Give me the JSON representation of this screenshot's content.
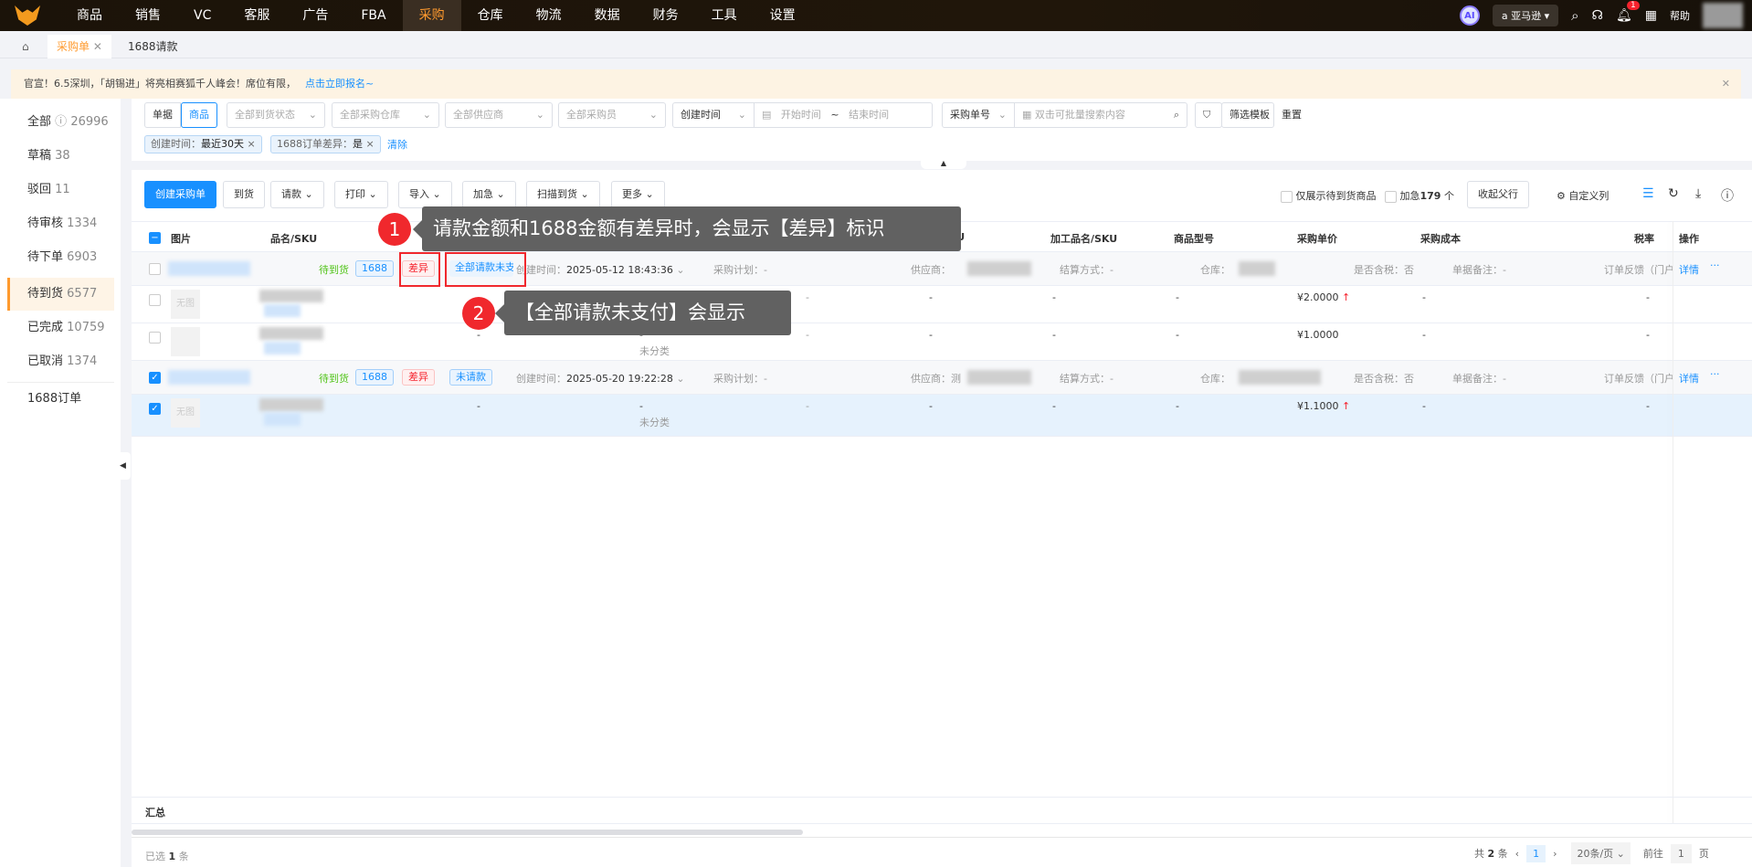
{
  "nav": {
    "items": [
      "商品",
      "销售",
      "VC",
      "客服",
      "广告",
      "FBA",
      "采购",
      "仓库",
      "物流",
      "数据",
      "财务",
      "工具",
      "设置"
    ],
    "active": "采购",
    "ai_label": "AI",
    "store": "亚马逊",
    "help": "帮助",
    "notification_count": "1"
  },
  "tabs": [
    {
      "label": "采购单",
      "active": true
    },
    {
      "label": "1688请款"
    }
  ],
  "notice": {
    "text": "官宣！6.5深圳，「胡锡进」将亮相赛狐千人峰会！席位有限，",
    "link": "点击立即报名~"
  },
  "sidebar": {
    "items": [
      {
        "label": "全部",
        "count": "26996"
      },
      {
        "label": "草稿",
        "count": "38"
      },
      {
        "label": "驳回",
        "count": "11"
      },
      {
        "label": "待审核",
        "count": "1334"
      },
      {
        "label": "待下单",
        "count": "6903"
      },
      {
        "label": "待到货",
        "count": "6577",
        "active": true
      },
      {
        "label": "已完成",
        "count": "10759"
      },
      {
        "label": "已取消",
        "count": "1374"
      },
      {
        "label": "1688订单",
        "count": ""
      }
    ]
  },
  "filters": {
    "toggle": [
      "单据",
      "商品"
    ],
    "arrival_status": "全部到货状态",
    "warehouse": "全部采购仓库",
    "supplier": "全部供应商",
    "buyer": "全部采购员",
    "time_type": "创建时间",
    "start": "开始时间",
    "sep": "~",
    "end": "结束时间",
    "search_type": "采购单号",
    "search_placeholder": "双击可批量搜索内容",
    "template": "筛选模板",
    "reset": "重置",
    "chips": [
      {
        "label": "创建时间：",
        "value": "最近30天"
      },
      {
        "label": "1688订单差异：",
        "value": "是"
      }
    ],
    "clear": "清除"
  },
  "toolbar": {
    "create": "创建采购单",
    "arrive": "到货",
    "request": "请款",
    "print": "打印",
    "import": "导入",
    "urgent": "加急",
    "scan": "扫描到货",
    "more": "更多",
    "only_pending": "仅展示待到货商品",
    "urgent_count_label": "加急",
    "urgent_count": "179",
    "urgent_unit": "个",
    "collapse": "收起父行",
    "custom_cols": "自定义列"
  },
  "table": {
    "headers": {
      "image": "图片",
      "name": "品名/SKU",
      "fnsku": "SKU",
      "process": "加工品名/SKU",
      "model": "商品型号",
      "price": "采购单价",
      "cost": "采购成本",
      "tax": "税率",
      "ops": "操作"
    },
    "groups": [
      {
        "checked": false,
        "status": "待到货",
        "tag1688": "1688",
        "diff": "差异",
        "pay": "全部请款未支",
        "created_label": "创建时间：",
        "created": "2025-05-12 18:43:36",
        "plan": "采购计划：-",
        "supplier": "供应商：",
        "settle": "结算方式：-",
        "warehouse": "仓库：",
        "tax_incl": "是否含税：否",
        "remark": "单据备注：-",
        "feedback": "订单反馈（门户）",
        "detail": "详情",
        "rows": [
          {
            "checked": false,
            "noimg": "无图",
            "dash": "-",
            "price": "¥2.0000",
            "up": true,
            "category": ""
          },
          {
            "checked": false,
            "noimg": "",
            "dash": "-",
            "price": "¥1.0000",
            "up": false,
            "category": "未分类"
          }
        ]
      },
      {
        "checked": true,
        "status": "待到货",
        "tag1688": "1688",
        "diff": "差异",
        "pay": "未请款",
        "created_label": "创建时间：",
        "created": "2025-05-20 19:22:28",
        "plan": "采购计划：-",
        "supplier": "供应商：测",
        "settle": "结算方式：-",
        "warehouse": "仓库：",
        "tax_incl": "是否含税：否",
        "remark": "单据备注：-",
        "feedback": "订单反馈（门户）",
        "detail": "详情",
        "rows": [
          {
            "checked": true,
            "noimg": "无图",
            "dash": "-",
            "price": "¥1.1000",
            "up": true,
            "category": "未分类"
          }
        ]
      }
    ]
  },
  "summary": "汇总",
  "footer": {
    "selected_prefix": "已选",
    "selected": "1",
    "selected_suffix": "条",
    "total_prefix": "共",
    "total": "2",
    "total_suffix": "条",
    "page": "1",
    "page_size": "20条/页",
    "goto": "前往",
    "goto_page": "1",
    "page_unit": "页"
  },
  "annotations": [
    {
      "num": "1",
      "text": "请款金额和1688金额有差异时，会显示【差异】标识"
    },
    {
      "num": "2",
      "text": "【全部请款未支付】会显示"
    }
  ]
}
